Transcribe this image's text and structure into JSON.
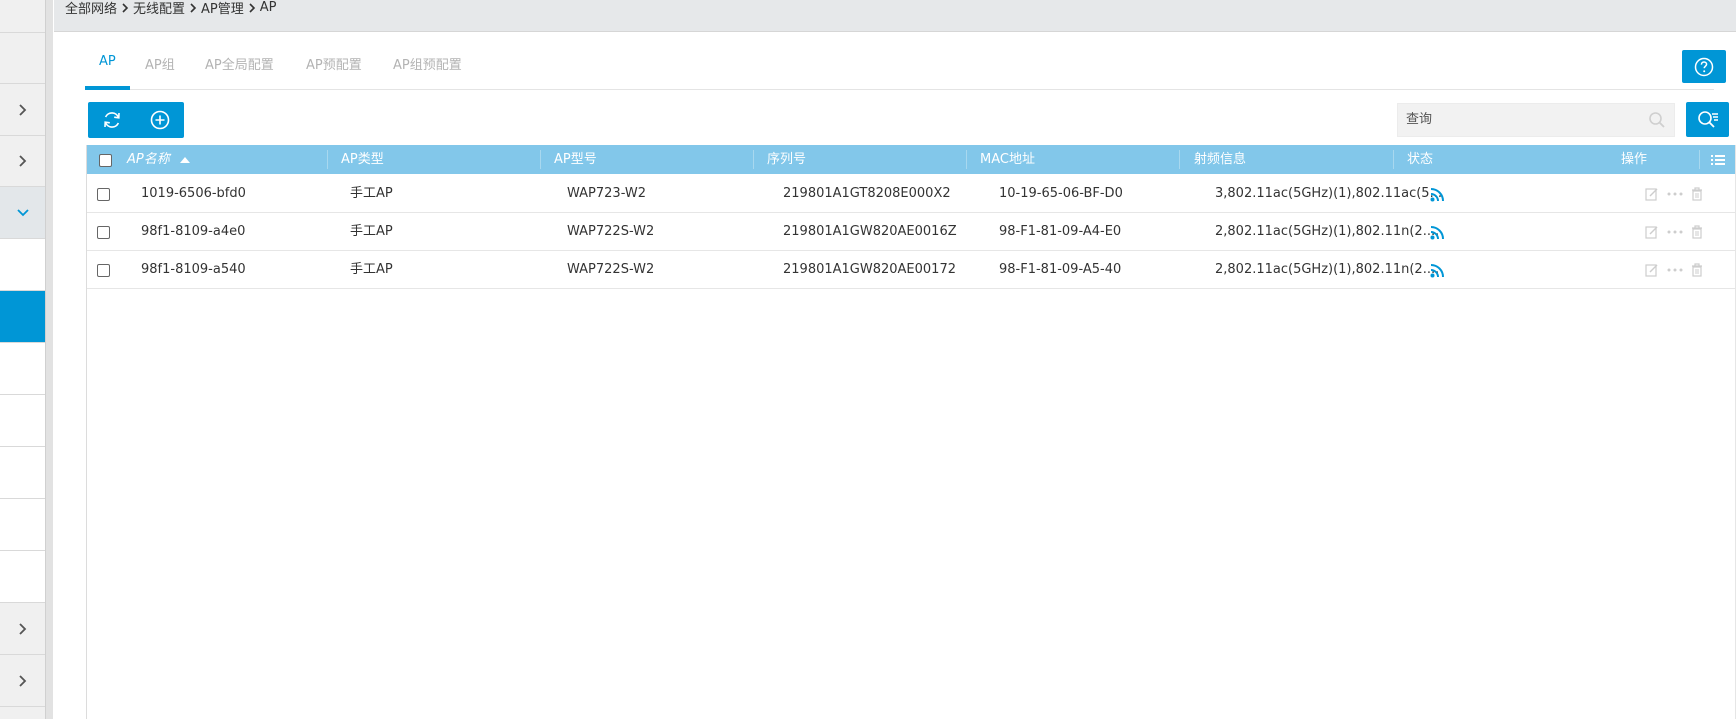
{
  "breadcrumb": [
    "全部网络",
    "无线配置",
    "AP管理",
    "AP"
  ],
  "tabs": [
    {
      "label": "AP",
      "active": true
    },
    {
      "label": "AP组",
      "active": false
    },
    {
      "label": "AP全局配置",
      "active": false
    },
    {
      "label": "AP预配置",
      "active": false
    },
    {
      "label": "AP组预配置",
      "active": false
    }
  ],
  "search": {
    "placeholder": "查询"
  },
  "table": {
    "columns": [
      "AP名称",
      "AP类型",
      "AP型号",
      "序列号",
      "MAC地址",
      "射频信息",
      "状态",
      "操作"
    ],
    "sort_column": "AP名称",
    "sort_direction": "ascending",
    "rows": [
      {
        "name": "1019-6506-bfd0",
        "type": "手工AP",
        "model": "WAP723-W2",
        "serial": "219801A1GT8208E000X2",
        "mac": "10-19-65-06-BF-D0",
        "radio": "3,802.11ac(5GHz)(1),802.11ac(5...",
        "status": "online-icon"
      },
      {
        "name": "98f1-8109-a4e0",
        "type": "手工AP",
        "model": "WAP722S-W2",
        "serial": "219801A1GW820AE0016Z",
        "mac": "98-F1-81-09-A4-E0",
        "radio": "2,802.11ac(5GHz)(1),802.11n(2....",
        "status": "online-icon"
      },
      {
        "name": "98f1-8109-a540",
        "type": "手工AP",
        "model": "WAP722S-W2",
        "serial": "219801A1GW820AE00172",
        "mac": "98-F1-81-09-A5-40",
        "radio": "2,802.11ac(5GHz)(1),802.11n(2....",
        "status": "online-icon"
      }
    ]
  },
  "colors": {
    "accent": "#0096d6",
    "header_bg": "#82c7ea",
    "topbar_bg": "#e6e8ea"
  }
}
